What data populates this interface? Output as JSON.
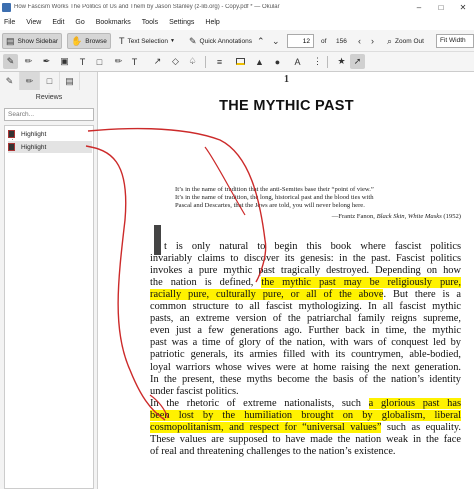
{
  "window": {
    "title": "How Fascism Works The Politics of Us and Them by Jason Stanley (z-lib.org) - Copy.pdf * — Okular",
    "minimize": "–",
    "maximize": "□",
    "close": "✕"
  },
  "menu": [
    "File",
    "View",
    "Edit",
    "Go",
    "Bookmarks",
    "Tools",
    "Settings",
    "Help"
  ],
  "toolbar": {
    "show_sidebar": "Show Sidebar",
    "browse": "Browse",
    "text_selection": "Text Selection",
    "quick_annotations": "Quick Annotations",
    "page_current": "12",
    "page_of": "of",
    "page_total": "156",
    "zoom_out": "Zoom Out",
    "zoom_mode": "Fit Width"
  },
  "sidebar": {
    "title": "Reviews",
    "search_placeholder": "Search...",
    "items": [
      {
        "label": "Highlight"
      },
      {
        "label": "Highlight"
      }
    ]
  },
  "document": {
    "page_number": "1",
    "chapter_title": "THE MYTHIC PAST",
    "epigraph": [
      "It’s in the name of tradition that the anti-Semites base their “point of view.”",
      "It’s in the name of tradition, the long, historical past and the blood ties with",
      "Pascal and Descartes, that the Jews are told, you will never belong here."
    ],
    "epigraph_attr_prefix": "—Frantz Fanon, ",
    "epigraph_attr_title": "Black Skin, White Masks",
    "epigraph_attr_year": " (1952)",
    "body": [
      {
        "pre": "t is only natural to begin this book where fascist politics",
        "hl": "",
        "post": ""
      },
      {
        "pre": "invariably claims to discover its genesis: in the past. Fascist politics",
        "hl": "",
        "post": ""
      },
      {
        "pre": "invokes a pure mythic past tragically destroyed. Depending on how",
        "hl": "",
        "post": ""
      },
      {
        "pre": "the nation is defined, ",
        "hl": "the mythic past may be religiously pure,",
        "post": ""
      },
      {
        "pre": "",
        "hl": "racially pure, culturally pure, or all of the above",
        "post": ". But there is a"
      },
      {
        "pre": "common structure to all fascist mythologizing. In all fascist mythic",
        "hl": "",
        "post": ""
      },
      {
        "pre": "pasts, an extreme version of the patriarchal family reigns supreme,",
        "hl": "",
        "post": ""
      },
      {
        "pre": "even just a few generations ago. Further back in time, the mythic",
        "hl": "",
        "post": ""
      },
      {
        "pre": "past was a time of glory of the nation, with wars of conquest led by",
        "hl": "",
        "post": ""
      },
      {
        "pre": "patriotic generals, its armies filled with its countrymen, able-bodied,",
        "hl": "",
        "post": ""
      },
      {
        "pre": "loyal warriors whose wives were at home raising the next generation.",
        "hl": "",
        "post": ""
      },
      {
        "pre": "In the present, these myths become the basis of the nation’s identity",
        "hl": "",
        "post": ""
      },
      {
        "pre": "under fascist politics.",
        "hl": "",
        "post": "",
        "last": true
      },
      {
        "pre": "    In the rhetoric of extreme nationalists, such ",
        "hl": "a glorious past has",
        "post": ""
      },
      {
        "pre": "",
        "hl": "been lost by the humiliation brought on by globalism, liberal",
        "post": ""
      },
      {
        "pre": "",
        "hl": "cosmopolitanism, and respect for “universal values”",
        "post": " such as equality."
      },
      {
        "pre": "These values are supposed to have made the nation weak in the face",
        "hl": "",
        "post": ""
      },
      {
        "pre": "of real and threatening challenges to the nation’s existence.",
        "hl": "",
        "post": "",
        "last": true
      }
    ]
  },
  "colors": {
    "highlight": "#fff200",
    "ink": "#cc2a2a"
  },
  "icons": {
    "sidebar_tabs": [
      "thumbnails-icon",
      "annotations-icon",
      "bookmarks-icon",
      "layers-icon"
    ]
  }
}
